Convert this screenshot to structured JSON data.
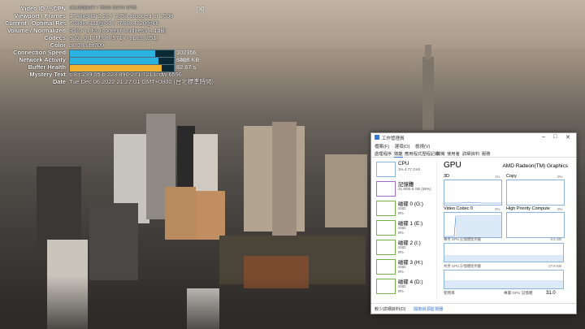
{
  "overlay": {
    "close": "[X]",
    "rows": [
      {
        "key": "Video ID / sCPN",
        "value": "zCL039j2k2Y / 7BGS SG7N XF35"
      },
      {
        "key": "Viewport / Frames",
        "value": "1746x982*2.20 / 1358 dropped of 1598"
      },
      {
        "key": "Current / Optimal Res",
        "value": "7680x4320@60 / 7680x4320@60"
      },
      {
        "key": "Volume / Normalized",
        "value": "30% / 19% (content loudness 4.1dB)"
      },
      {
        "key": "Codecs",
        "value": "av01.0.17M.08 (571) / opus (251)"
      },
      {
        "key": "Color",
        "value": "bt709 / bt709"
      },
      {
        "key": "Connection Speed",
        "value": "102356 Kbps"
      },
      {
        "key": "Network Activity",
        "value": "3408 KB"
      },
      {
        "key": "Buffer Health",
        "value": "82.67 s"
      },
      {
        "key": "Mystery Text",
        "value": "s:8 t:239.05 b:223.890-271.721 L:dw 6596"
      },
      {
        "key": "Date",
        "value": "Tue Dec 06 2022 21:27:01 GMT+0800 (台北標準時間)"
      }
    ],
    "connection_bar_fill": 0.82,
    "network_bar_fill": 0.85,
    "buffer_bar_fill": 0.88
  },
  "taskmanager": {
    "title": "工作管理員",
    "menu": [
      "檔案(F)",
      "選項(O)",
      "檢視(V)"
    ],
    "tabs": [
      "處理程序",
      "效能",
      "應用程式歷程記錄",
      "開機",
      "使用者",
      "詳細資料",
      "服務"
    ],
    "active_tab": 1,
    "sidebar": [
      {
        "name": "CPU",
        "sub": "1% 4.77 GHz",
        "kind": "cpu"
      },
      {
        "name": "記憶體",
        "sub": "21.8/55.6 GB (39%)",
        "kind": "mem"
      },
      {
        "name": "磁碟 0 (G:)",
        "sub": "SSD\n0%",
        "kind": "disk"
      },
      {
        "name": "磁碟 1 (E:)",
        "sub": "SSD\n0%",
        "kind": "disk"
      },
      {
        "name": "磁碟 2 (I:)",
        "sub": "SSD\n0%",
        "kind": "disk"
      },
      {
        "name": "磁碟 3 (H:)",
        "sub": "SSD\n0%",
        "kind": "disk"
      },
      {
        "name": "磁碟 4 (D:)",
        "sub": "SSD\n0%",
        "kind": "disk"
      }
    ],
    "gpu": {
      "heading": "GPU",
      "name": "AMD Radeon(TM) Graphics",
      "graphs": [
        {
          "label": "3D",
          "pct": "1%"
        },
        {
          "label": "Copy",
          "pct": "0%"
        },
        {
          "label": "Video Codec 0",
          "pct": "0%"
        },
        {
          "label": "High Priority Compute",
          "pct": "0%"
        }
      ],
      "dedicated_label": "專用 GPU 記憶體使用量",
      "dedicated_max": "0.5 GB",
      "shared_label": "共用 GPU 記憶體使用量",
      "shared_max": "27.8 GB",
      "bottom_left": "使用率",
      "bottom_right": "專屬 GPU 記憶體",
      "bottom_value": "31.0"
    },
    "footer": {
      "less": "較少詳細資料(D)",
      "monitor": "開啟資源監視器"
    }
  }
}
